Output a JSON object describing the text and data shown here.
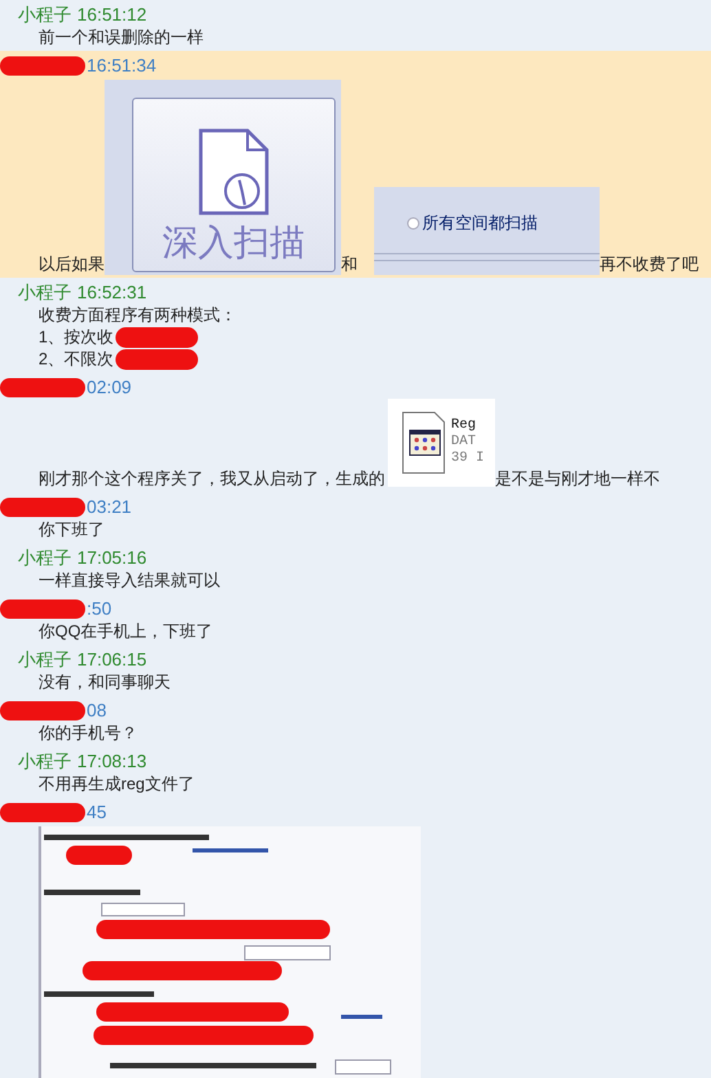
{
  "messages": [
    {
      "sender": "小程子",
      "time": "16:51:12",
      "kind": "peer",
      "highlighted": false,
      "rows": [
        [
          {
            "kind": "text",
            "text": "前一个和误删除的一样"
          }
        ]
      ]
    },
    {
      "time": "16:51:34",
      "kind": "self",
      "name_redacted": true,
      "highlighted": true,
      "rows": [
        [
          {
            "kind": "text",
            "text": "以后如果"
          },
          {
            "kind": "scan_image",
            "label": "深入扫描"
          },
          {
            "kind": "text",
            "text": "和"
          },
          {
            "kind": "radio_image",
            "label": "所有空间都扫描",
            "checked": false
          },
          {
            "kind": "text",
            "text": "再不收费了吧"
          }
        ]
      ]
    },
    {
      "sender": "小程子",
      "time": "16:52:31",
      "kind": "peer",
      "highlighted": false,
      "rows": [
        [
          {
            "kind": "text",
            "text": "收费方面程序有两种模式："
          }
        ],
        [
          {
            "kind": "text",
            "text": "1、按次收"
          },
          {
            "kind": "redaction"
          }
        ],
        [
          {
            "kind": "text",
            "text": "2、不限次"
          },
          {
            "kind": "redaction"
          }
        ]
      ]
    },
    {
      "time": "02:09",
      "kind": "self",
      "name_redacted": true,
      "highlighted": false,
      "rows": [
        [
          {
            "kind": "text",
            "text": "刚才那个这个程序关了，我又从启动了，生成的"
          },
          {
            "kind": "file_image",
            "name": "Reg",
            "type": "DAT",
            "size": "39 I"
          },
          {
            "kind": "text",
            "text": "是不是与刚才地一样不"
          }
        ]
      ]
    },
    {
      "time": "03:21",
      "kind": "self",
      "name_redacted": true,
      "highlighted": false,
      "rows": [
        [
          {
            "kind": "text",
            "text": "你下班了"
          }
        ]
      ]
    },
    {
      "sender": "小程子",
      "time": "17:05:16",
      "kind": "peer",
      "highlighted": false,
      "rows": [
        [
          {
            "kind": "text",
            "text": "一样直接导入结果就可以"
          }
        ]
      ]
    },
    {
      "time": ":50",
      "kind": "self",
      "name_redacted": true,
      "highlighted": false,
      "rows": [
        [
          {
            "kind": "text",
            "text": "你QQ在手机上，下班了"
          }
        ]
      ]
    },
    {
      "sender": "小程子",
      "time": "17:06:15",
      "kind": "peer",
      "highlighted": false,
      "rows": [
        [
          {
            "kind": "text",
            "text": "没有，和同事聊天"
          }
        ]
      ]
    },
    {
      "time": "08",
      "kind": "self",
      "name_redacted": true,
      "highlighted": false,
      "rows": [
        [
          {
            "kind": "text",
            "text": "你的手机号？"
          }
        ]
      ]
    },
    {
      "sender": "小程子",
      "time": "17:08:13",
      "kind": "peer",
      "highlighted": false,
      "rows": [
        [
          {
            "kind": "text",
            "text": "不用再生成reg文件了"
          }
        ]
      ]
    },
    {
      "time": "45",
      "kind": "self",
      "name_redacted": true,
      "highlighted": false
    }
  ]
}
